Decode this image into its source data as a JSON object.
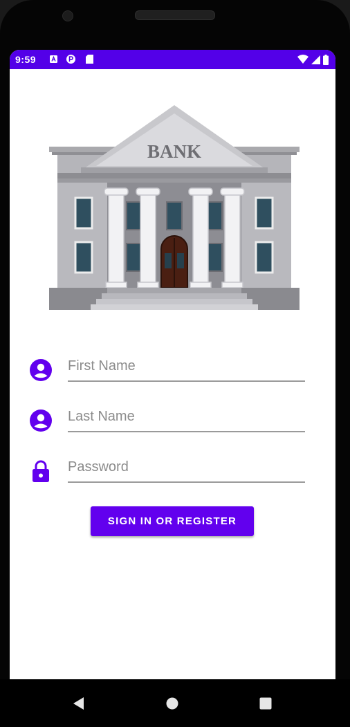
{
  "status_bar": {
    "time": "9:59",
    "notification_icons": [
      "a-badge-icon",
      "p-badge-icon",
      "sd-card-icon"
    ],
    "right_icons": [
      "wifi-icon",
      "signal-icon",
      "battery-icon"
    ],
    "color": "#5300e8"
  },
  "hero": {
    "building_sign": "BANK",
    "icon": "bank-building-illustration"
  },
  "form": {
    "first_name": {
      "placeholder": "First Name",
      "value": "",
      "icon": "account-circle-icon"
    },
    "last_name": {
      "placeholder": "Last Name",
      "value": "",
      "icon": "account-circle-icon"
    },
    "password": {
      "placeholder": "Password",
      "value": "",
      "icon": "lock-icon"
    },
    "submit_label": "SIGN IN OR REGISTER",
    "accent_color": "#6200ee"
  },
  "nav_bar": {
    "buttons": [
      "back-icon",
      "home-icon",
      "recents-icon"
    ]
  }
}
